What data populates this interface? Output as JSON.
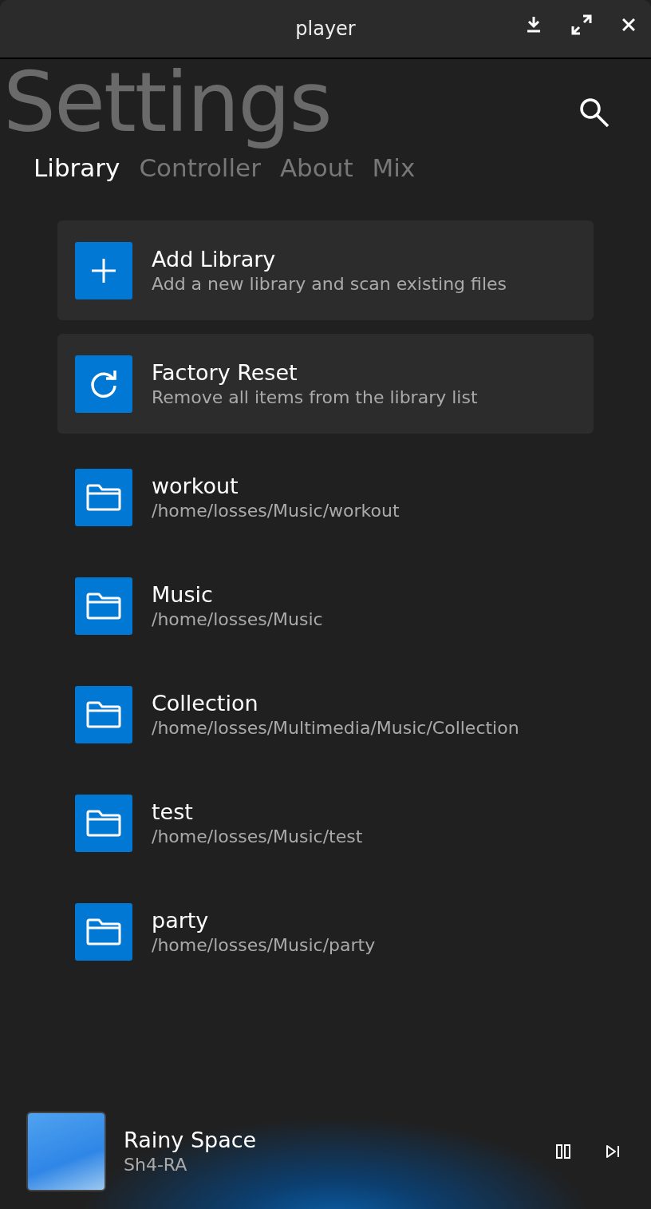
{
  "window": {
    "title": "player"
  },
  "heading": "Settings",
  "tabs": [
    {
      "label": "Library",
      "selected": true
    },
    {
      "label": "Controller",
      "selected": false
    },
    {
      "label": "About",
      "selected": false
    },
    {
      "label": "Mix",
      "selected": false
    }
  ],
  "items": [
    {
      "kind": "add",
      "title": "Add Library",
      "subtitle": "Add a new library and scan existing files"
    },
    {
      "kind": "reset",
      "title": "Factory Reset",
      "subtitle": "Remove all items from the library list"
    },
    {
      "kind": "folder",
      "title": "workout",
      "subtitle": "/home/losses/Music/workout"
    },
    {
      "kind": "folder",
      "title": "Music",
      "subtitle": "/home/losses/Music"
    },
    {
      "kind": "folder",
      "title": "Collection",
      "subtitle": "/home/losses/Multimedia/Music/Collection"
    },
    {
      "kind": "folder",
      "title": "test",
      "subtitle": "/home/losses/Music/test"
    },
    {
      "kind": "folder",
      "title": "party",
      "subtitle": "/home/losses/Music/party"
    }
  ],
  "now_playing": {
    "title": "Rainy Space",
    "artist": "Sh4-RA"
  }
}
